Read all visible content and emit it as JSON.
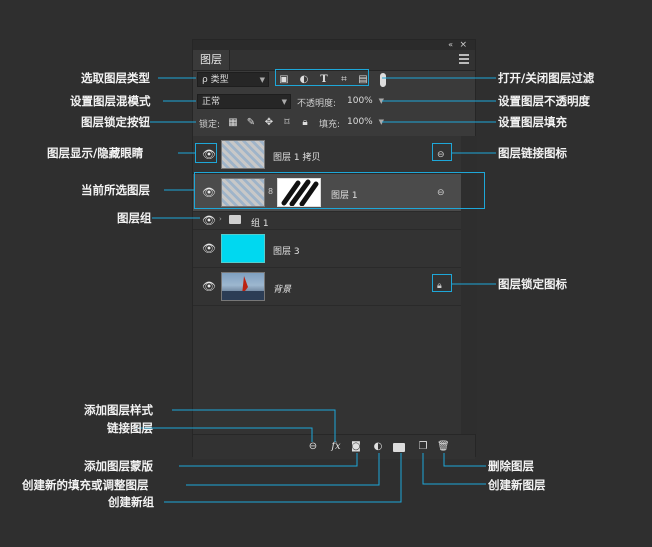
{
  "panel": {
    "tab_label": "图层",
    "collapse_glyph": "«",
    "close_glyph": "×",
    "filter_kind": "ρ 类型",
    "blend_mode": "正常",
    "opacity_label": "不透明度:",
    "opacity_value": "100%",
    "lock_label": "锁定:",
    "fill_label": "填充:",
    "fill_value": "100%"
  },
  "layers": [
    {
      "name": "图层 1 拷贝"
    },
    {
      "name": "图层 1"
    },
    {
      "name": "组 1"
    },
    {
      "name": "图层 3"
    },
    {
      "name": "背景"
    }
  ],
  "annotations": {
    "left": [
      "选取图层类型",
      "设置图层混模式",
      "图层锁定按钮",
      "图层显示/隐藏眼睛",
      "当前所选图层",
      "图层组",
      "添加图层样式",
      "链接图层",
      "添加图层蒙版",
      "创建新的填充或调整图层",
      "创建新组"
    ],
    "right": [
      "打开/关闭图层过滤",
      "设置图层不透明度",
      "设置图层填充",
      "图层链接图标",
      "图层锁定图标",
      "删除图层",
      "创建新图层"
    ]
  },
  "colors": {
    "accent": "#1ea7d8",
    "layer3_fill": "#00d8f0",
    "selected_row": "#4b4b4b"
  },
  "icons": [
    "search-icon",
    "image-filter-icon",
    "circle-filter-icon",
    "text-filter-icon",
    "shape-filter-icon",
    "smart-filter-icon",
    "toggle-icon",
    "lock-pixels-icon",
    "brush-icon",
    "move-icon",
    "artboard-icon",
    "padlock-icon",
    "eye-icon",
    "link-icon",
    "folder-icon",
    "fx-icon",
    "mask-icon",
    "adjustment-icon",
    "new-layer-icon",
    "trash-icon"
  ]
}
